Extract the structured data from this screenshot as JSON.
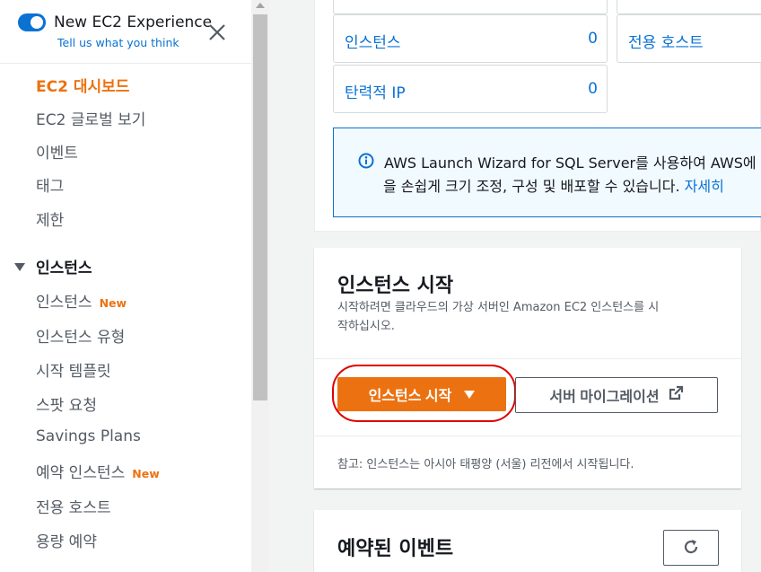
{
  "sidebar": {
    "toggle_title": "New EC2 Experience",
    "toggle_subtitle": "Tell us what you think",
    "items": [
      {
        "label": "EC2 대시보드"
      },
      {
        "label": "EC2 글로벌 보기"
      },
      {
        "label": "이벤트"
      },
      {
        "label": "태그"
      },
      {
        "label": "제한"
      }
    ],
    "group_instances": "인스턴스",
    "instance_items": [
      {
        "label": "인스턴스",
        "badge": "New"
      },
      {
        "label": "인스턴스 유형"
      },
      {
        "label": "시작 템플릿"
      },
      {
        "label": "스팟 요청"
      },
      {
        "label": "Savings Plans"
      },
      {
        "label": "예약 인스턴스",
        "badge": "New"
      },
      {
        "label": "전용 호스트"
      },
      {
        "label": "용량 예약"
      }
    ]
  },
  "resources": {
    "instances_label": "인스턴스",
    "instances_count": "0",
    "dedicated_hosts_label": "전용 호스트",
    "elastic_ip_label": "탄력적 IP",
    "elastic_ip_count": "0"
  },
  "info": {
    "line1": "AWS Launch Wizard for SQL Server를 사용하여 AWS에",
    "line2": "을 손쉽게 크기 조정, 구성 및 배포할 수 있습니다.",
    "link": "자세히"
  },
  "launch": {
    "title": "인스턴스 시작",
    "desc_line1": "시작하려면 클라우드의 가상 서버인 Amazon EC2 인스턴스를 시",
    "desc_line2": "작하십시오.",
    "launch_button": "인스턴스 시작",
    "migrate_button": "서버 마이그레이션",
    "note": "참고: 인스턴스는 아시아 태평양 (서울) 리전에서 시작됩니다."
  },
  "events": {
    "title": "예약된 이벤트"
  },
  "colors": {
    "accent": "#ec7211",
    "link": "#0972d3",
    "highlight": "#e00000"
  }
}
